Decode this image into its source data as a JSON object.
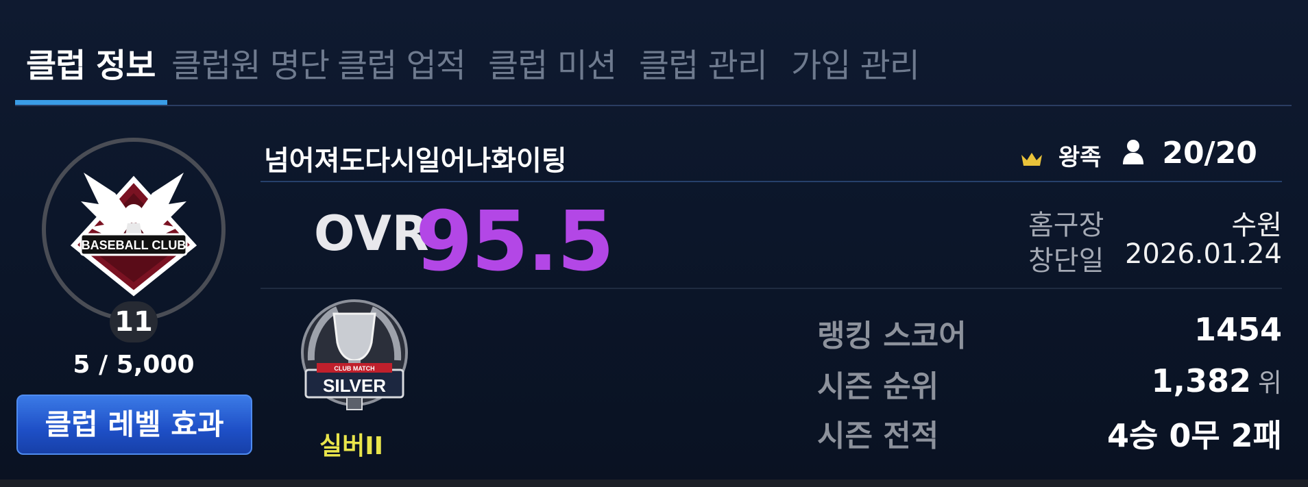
{
  "tabs": [
    {
      "label": "클럽 정보",
      "active": true
    },
    {
      "label": "클럽원 명단",
      "active": false
    },
    {
      "label": "클럽 업적",
      "active": false
    },
    {
      "label": "클럽 미션",
      "active": false
    },
    {
      "label": "클럽 관리",
      "active": false
    },
    {
      "label": "가입 관리",
      "active": false
    }
  ],
  "club": {
    "name": "넘어져도다시일어나화이팅",
    "emblem_text": "BASEBALL CLUB",
    "level": "11",
    "exp": "5 / 5,000",
    "level_effect_button": "클럽 레벨 효과",
    "grade": "왕족",
    "members": "20/20",
    "ovr_label": "OVR",
    "ovr_value": "95.5",
    "home_label": "홈구장",
    "home_value": "수원",
    "founded_label": "창단일",
    "founded_value": "2026.01.24"
  },
  "league": {
    "badge_top": "CLUB MATCH",
    "badge_text": "SILVER",
    "label": "실버II"
  },
  "stats": {
    "ranking_label": "랭킹 스코어",
    "ranking_value": "1454",
    "season_rank_label": "시즌 순위",
    "season_rank_value": "1,382",
    "season_rank_unit": "위",
    "season_record_label": "시즌 전적",
    "season_record_value": "4승 0무 2패"
  },
  "colors": {
    "accent_tab": "#3a9ce6",
    "ovr": "#b347e6",
    "league": "#e9e54b",
    "button": "#2a60d6"
  }
}
